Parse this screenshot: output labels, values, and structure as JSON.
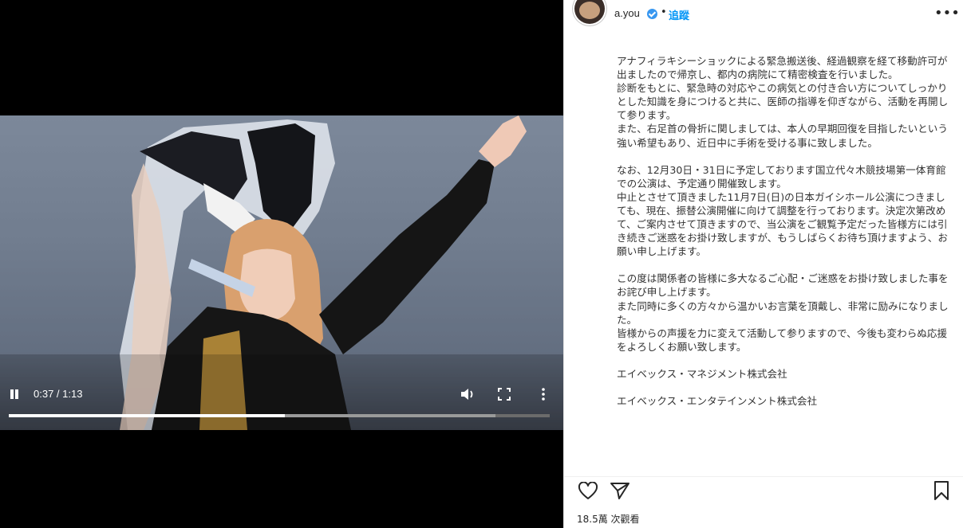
{
  "video": {
    "time": "0:37 / 1:13",
    "progress_played": 0.51,
    "progress_buffered": 0.9
  },
  "post": {
    "username": "a.you",
    "separator": "•",
    "follow_label": "追蹤",
    "more_label": "•••",
    "caption": [
      "アナフィラキシーショックによる緊急搬送後、経過観察を経て移動許可が出ましたので帰京し、都内の病院にて精密検査を行いました。",
      "診断をもとに、緊急時の対応やこの病気との付き合い方についてしっかりとした知識を身につけると共に、医師の指導を仰ぎながら、活動を再開して参ります。",
      "また、右足首の骨折に関しましては、本人の早期回復を目指したいという強い希望もあり、近日中に手術を受ける事に致しました。",
      "なお、12月30日・31日に予定しております国立代々木競技場第一体育館での公演は、予定通り開催致します。",
      "中止とさせて頂きました11月7日(日)の日本ガイシホール公演につきましても、現在、振替公演開催に向けて調整を行っております。決定次第改めて、ご案内させて頂きますので、当公演をご観覧予定だった皆様方には引き続きご迷惑をお掛け致しますが、もうしばらくお待ち頂けますよう、お願い申し上げます。",
      "この度は関係者の皆様に多大なるご心配・ご迷惑をお掛け致しました事をお詫び申し上げます。",
      "また同時に多くの方々から温かいお言葉を頂戴し、非常に励みになりました。",
      "皆様からの声援を力に変えて活動して参りますので、今後も変わらぬ応援をよろしくお願い致します。",
      "エイベックス・マネジメント株式会社",
      "エイベックス・エンタテインメント株式会社"
    ],
    "views": "18.5萬 次觀看"
  }
}
